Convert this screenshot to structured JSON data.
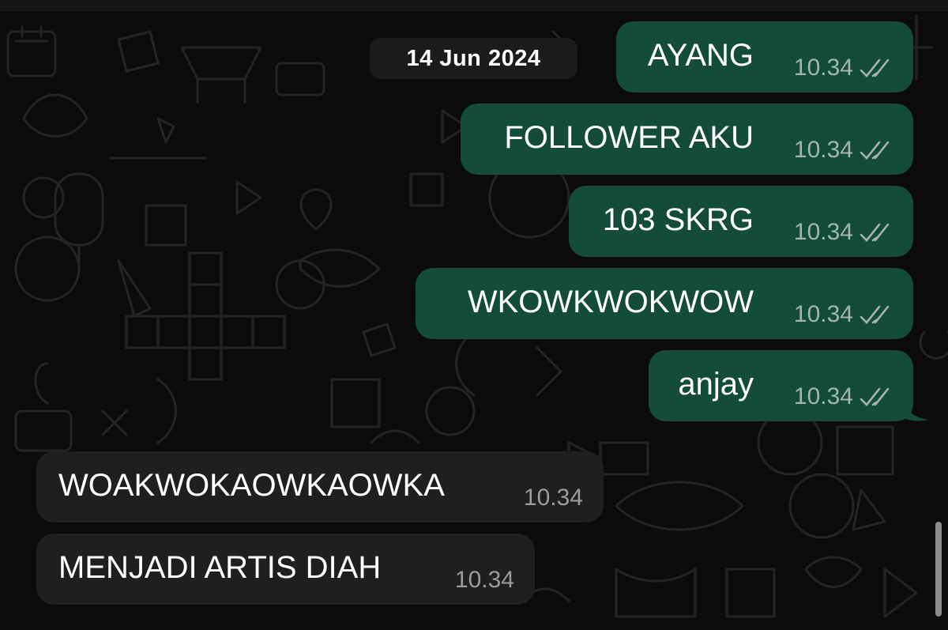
{
  "chat": {
    "date_label": "14 Jun 2024",
    "outgoing": [
      {
        "text": "AYANG",
        "time": "10.34",
        "status": "read"
      },
      {
        "text": "FOLLOWER AKU",
        "time": "10.34",
        "status": "read"
      },
      {
        "text": "103 SKRG",
        "time": "10.34",
        "status": "read"
      },
      {
        "text": "WKOWKWOKWOW",
        "time": "10.34",
        "status": "read"
      },
      {
        "text": "anjay",
        "time": "10.34",
        "status": "read"
      }
    ],
    "incoming": [
      {
        "text": "WOAKWOKAOWKAOWKA",
        "time": "10.34"
      },
      {
        "text": "MENJADI ARTIS DIAH",
        "time": "10.34"
      }
    ]
  },
  "icons": {
    "read_receipt": "double-check-icon",
    "wallpaper": "chat-doodle-pattern"
  },
  "colors": {
    "background": "#0b0b0b",
    "outgoing_bubble": "#134d37",
    "incoming_bubble": "#1f1f1f",
    "date_chip": "#1b1b1b",
    "text": "#ffffff",
    "outgoing_time": "#a5b4ad",
    "incoming_time": "#9c9c9c"
  }
}
